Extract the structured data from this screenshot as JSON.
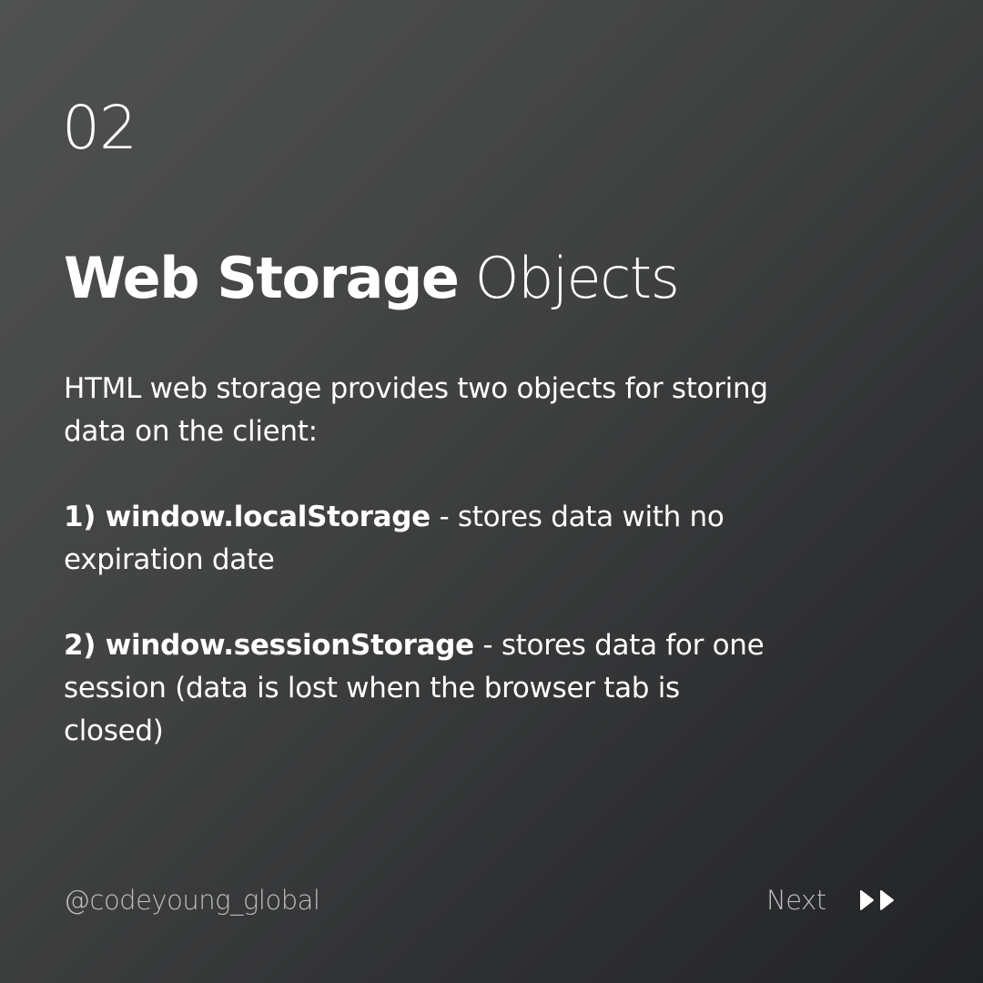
{
  "slide": {
    "number": "02",
    "title_bold": "Web Storage",
    "title_light": "Objects"
  },
  "content": {
    "intro": "HTML web storage provides two objects for storing data on the client:",
    "item1_bold": "1) window.localStorage",
    "item1_text": " - stores data with no expiration date",
    "item2_bold": "2) window.sessionStorage",
    "item2_text": " - stores data for one session (data is lost when the browser tab is closed)"
  },
  "footer": {
    "handle": "@codeyoung_global",
    "next_label": "Next",
    "next_icon": "double-play-icon"
  },
  "colors": {
    "background_top_left": "#505251",
    "background_bottom_right": "#222326",
    "text_primary": "#ffffff",
    "text_muted": "#bdbebf"
  }
}
